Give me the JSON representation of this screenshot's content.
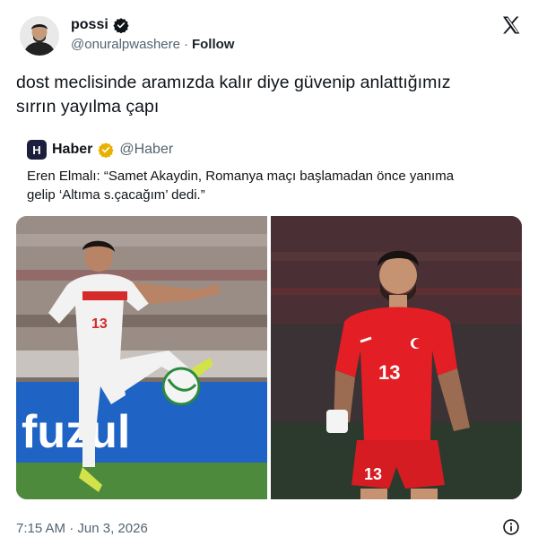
{
  "tweet": {
    "display_name": "possi",
    "handle": "@onuralpwashere",
    "separator": "·",
    "follow_label": "Follow",
    "text_line1": "dost meclisinde aramızda kalır diye güvenip anlattığımız",
    "text_line2": "sırrın yayılma çapı",
    "time": "7:15 AM",
    "date": "Jun 3, 2026",
    "timestamp_separator": "·",
    "brand_color": "#1d9bf0"
  },
  "quote": {
    "avatar_letter": "H",
    "display_name": "Haber",
    "handle": "@Haber",
    "verified_color": "#e8b100",
    "text_line1": "Eren Elmalı: “Samet Akaydin, Romanya maçı başlamadan önce yanıma",
    "text_line2": "gelip ‘Altıma s.çacağım’ dedi.”"
  },
  "photos": {
    "left": {
      "board_text": "fuzul",
      "jersey_number": "13"
    },
    "right": {
      "jersey_number": "13",
      "shorts_number": "13"
    }
  },
  "icons": {
    "verified": "verified-badge-icon",
    "x_logo": "x-logo-icon",
    "info": "info-icon"
  }
}
